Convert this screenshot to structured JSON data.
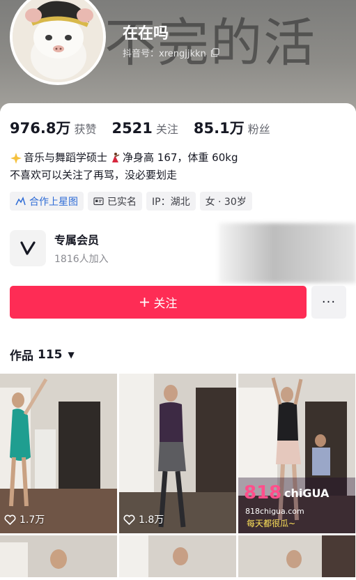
{
  "profile": {
    "cover_text": "不完的活",
    "nickname": "在在吗",
    "douyin_id": "抖音号：xrengjjkkn"
  },
  "stats": [
    {
      "value": "976.8万",
      "label": "获赞"
    },
    {
      "value": "2521",
      "label": "关注"
    },
    {
      "value": "85.1万",
      "label": "粉丝"
    }
  ],
  "bio": {
    "line1_a": "音乐与舞蹈学硕士",
    "line1_b": "净身高 167，体重 60kg",
    "line2": "不喜欢可以关注了再骂，没必要划走"
  },
  "tags": [
    {
      "label": "合作上星图",
      "icon": "star-map-icon"
    },
    {
      "label": "已实名",
      "icon": "id-card-icon"
    },
    {
      "label": "IP：湖北",
      "icon": ""
    },
    {
      "label": "女 · 30岁",
      "icon": ""
    }
  ],
  "member": {
    "title": "专属会员",
    "subtitle": "1816人加入"
  },
  "actions": {
    "follow_label": "关注",
    "more_label": "···"
  },
  "works": {
    "label": "作品",
    "count": "115"
  },
  "videos": [
    {
      "likes": "1.7万"
    },
    {
      "likes": "1.8万"
    },
    {
      "likes": ""
    }
  ],
  "colors": {
    "accent": "#fe2c55",
    "tag_blue": "#2f6cd6"
  }
}
